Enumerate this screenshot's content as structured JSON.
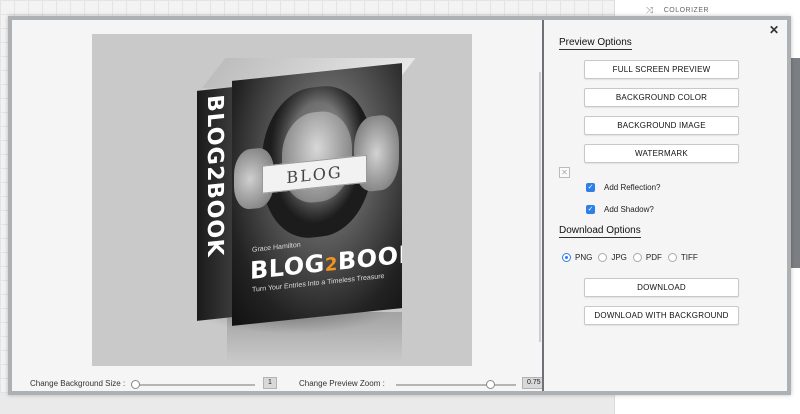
{
  "background": {
    "colorizer_label": "COLORIZER",
    "colorizer_icon": "shuffle-icon"
  },
  "preview": {
    "book": {
      "spine_title": "BLOG2BOOK",
      "paper_text": "BLOG",
      "author": "Grace Hamilton",
      "title_part1": "BLOG",
      "title_accent": "2",
      "title_part2": "BOOK",
      "subtitle": "Turn Your Entries Into a Timeless Treasure"
    },
    "bg_size": {
      "label": "Change Background Size :",
      "value": "1",
      "fraction": 0.0
    },
    "zoom": {
      "label": "Change Preview Zoom :",
      "value": "0.75",
      "fraction": 0.75
    }
  },
  "options": {
    "close_label": "✕",
    "preview_title": "Preview Options",
    "buttons": [
      {
        "label": "FULL SCREEN PREVIEW"
      },
      {
        "label": "BACKGROUND COLOR"
      },
      {
        "label": "BACKGROUND IMAGE"
      },
      {
        "label": "WATERMARK"
      }
    ],
    "add_reflection": {
      "label": "Add Reflection?",
      "checked": true
    },
    "add_shadow": {
      "label": "Add Shadow?",
      "checked": true
    },
    "download_title": "Download Options",
    "formats": [
      {
        "label": "PNG",
        "selected": true
      },
      {
        "label": "JPG",
        "selected": false
      },
      {
        "label": "PDF",
        "selected": false
      },
      {
        "label": "TIFF",
        "selected": false
      }
    ],
    "download_label": "DOWNLOAD",
    "download_bg_label": "DOWNLOAD WITH BACKGROUND"
  },
  "colors": {
    "accent": "#2f7fe8",
    "title_accent": "#f7941d"
  }
}
